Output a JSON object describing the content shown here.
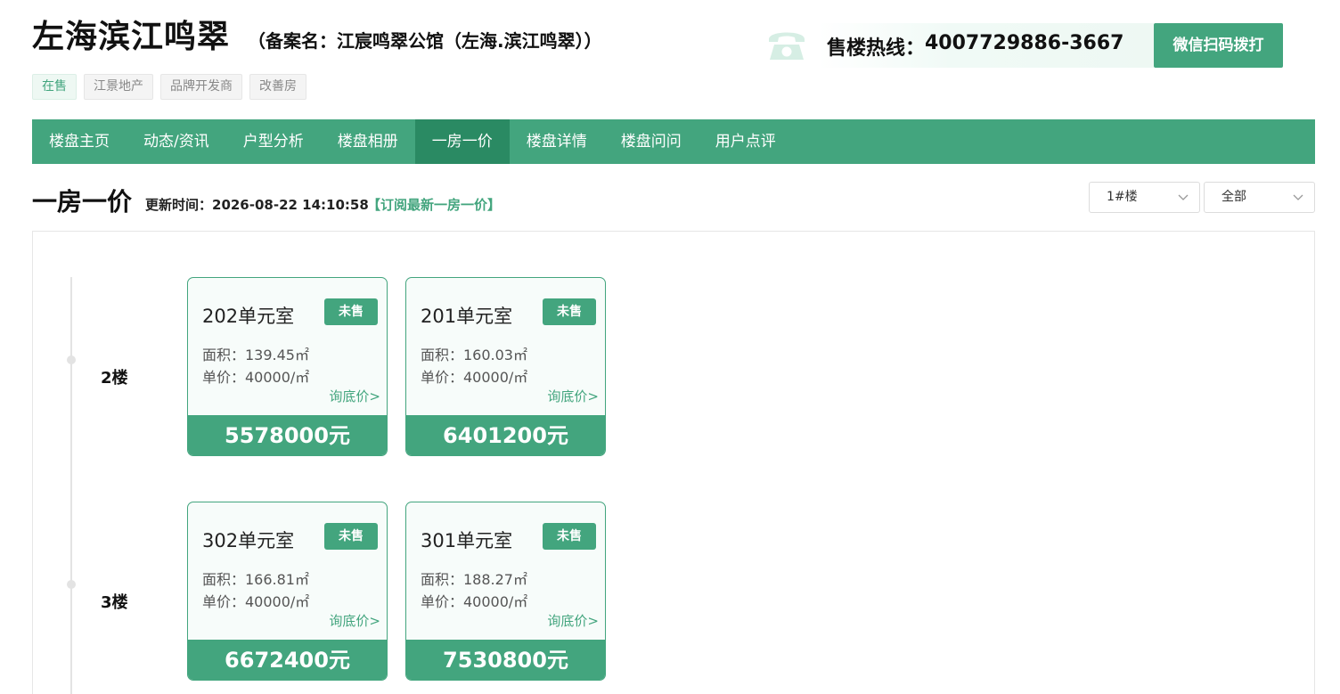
{
  "project": {
    "name": "左海滨江鸣翠",
    "record_name": "（备案名：江宸鸣翠公馆（左海.滨江鸣翠））",
    "tags": [
      "在售",
      "江景地产",
      "品牌开发商",
      "改善房"
    ]
  },
  "hotline": {
    "label": "售楼热线：",
    "number": "4007729886-3667",
    "scan_button": "微信扫码拨打"
  },
  "nav": {
    "items": [
      "楼盘主页",
      "动态/资讯",
      "户型分析",
      "楼盘相册",
      "一房一价",
      "楼盘详情",
      "楼盘问问",
      "用户点评"
    ],
    "active": "一房一价"
  },
  "section": {
    "title": "一房一价",
    "update_text": "更新时间：2026-08-22 14:10:58",
    "subscribe": "【订阅最新一房一价】"
  },
  "filters": {
    "building": "1#楼",
    "scope": "全部"
  },
  "floors": [
    {
      "label": "2楼",
      "units": [
        {
          "room": "202单元室",
          "status": "未售",
          "area": "面积：139.45㎡",
          "unit_price": "单价：40000/㎡",
          "inquire": "询底价>",
          "total": "5578000元"
        },
        {
          "room": "201单元室",
          "status": "未售",
          "area": "面积：160.03㎡",
          "unit_price": "单价：40000/㎡",
          "inquire": "询底价>",
          "total": "6401200元"
        }
      ]
    },
    {
      "label": "3楼",
      "units": [
        {
          "room": "302单元室",
          "status": "未售",
          "area": "面积：166.81㎡",
          "unit_price": "单价：40000/㎡",
          "inquire": "询底价>",
          "total": "6672400元"
        },
        {
          "room": "301单元室",
          "status": "未售",
          "area": "面积：188.27㎡",
          "unit_price": "单价：40000/㎡",
          "inquire": "询底价>",
          "total": "7530800元"
        }
      ]
    }
  ],
  "colors": {
    "brand": "#43a57e",
    "nav_active": "#2a8a63"
  },
  "icons": {
    "phone": "telephone-icon",
    "dropdown": "chevron-down-icon"
  }
}
